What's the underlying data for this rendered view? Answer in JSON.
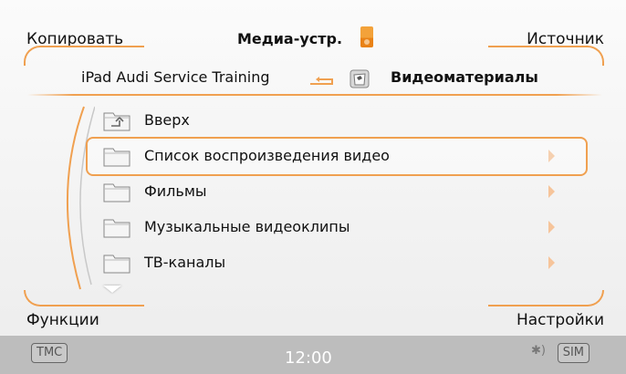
{
  "softkeys": {
    "top_left": "Копировать",
    "top_right": "Источник",
    "bottom_left": "Функции",
    "bottom_right": "Настройки"
  },
  "header": {
    "title": "Медиа-устр.",
    "device_icon": "ipod-icon"
  },
  "breadcrumb": {
    "source": "iPad Audi Service Training",
    "current": "Видеоматериалы",
    "back_icon": "return-arrow-icon",
    "folder_icon": "folder-icon"
  },
  "list": {
    "items": [
      {
        "label": "Вверх",
        "icon": "folder-up-icon",
        "chevron": false,
        "selected": false
      },
      {
        "label": "Список воспроизведения видео",
        "icon": "folder-icon",
        "chevron": true,
        "selected": true
      },
      {
        "label": "Фильмы",
        "icon": "folder-icon",
        "chevron": true,
        "selected": false
      },
      {
        "label": "Музыкальные видеоклипы",
        "icon": "folder-icon",
        "chevron": true,
        "selected": false
      },
      {
        "label": "ТВ-каналы",
        "icon": "folder-icon",
        "chevron": true,
        "selected": false
      }
    ]
  },
  "status_bar": {
    "tmc": "TMC",
    "time": "12:00",
    "sim": "SIM",
    "bluetooth_icon": "bluetooth-icon"
  },
  "colors": {
    "accent": "#f0a050",
    "status_bar": "#bdbdbd"
  }
}
